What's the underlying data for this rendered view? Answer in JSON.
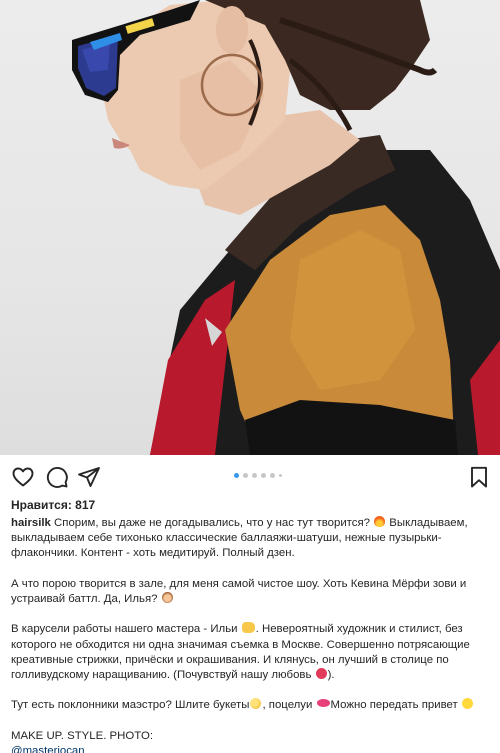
{
  "post": {
    "likes_text": "Нравится: 817",
    "username": "hairsilk",
    "caption_p1": " Спорим, вы даже не догадывались, что у нас тут творится? ",
    "caption_p1b": " Выкладываем, выкладываем себе тихонько классические баллаяжи-шатуши, нежные пузырьки-флакончики. Контент - хоть медитируй. Полный дзен.",
    "caption_p2a": "А что порою творится в зале, для меня самой чистое шоу. Хоть Кевина Мёрфи зови и устраивай баттл. Да, Илья? ",
    "caption_p3a": "В карусели работы нашего мастера - Ильи ",
    "caption_p3b": ". Невероятный  художник и стилист, без которого не обходится ни одна значимая съемка в Москве. Совершенно потрясающие креативные стрижки, причёски и окрашивания. И клянусь, он лучший в столице по голливудскому наращиванию. (Почувствуй нашу любовь ",
    "caption_p3c": ").",
    "caption_p4a": "Тут есть поклонники маэстро? Шлите букеты",
    "caption_p4b": ", поцелуи ",
    "caption_p4c": "Можно передать привет ",
    "caption_p5": "MAKE UP.  STYLE. PHOTO:",
    "mention": "@masteriocan"
  },
  "carousel": {
    "current": 1,
    "total": 6
  },
  "icons": {
    "like": "heart-outline-icon",
    "comment": "speech-bubble-icon",
    "share": "paper-plane-icon",
    "save": "bookmark-icon"
  },
  "colors": {
    "text": "#262626",
    "link": "#00376b",
    "carousel_active": "#3897f0",
    "carousel_inactive": "#c7c7c7"
  }
}
